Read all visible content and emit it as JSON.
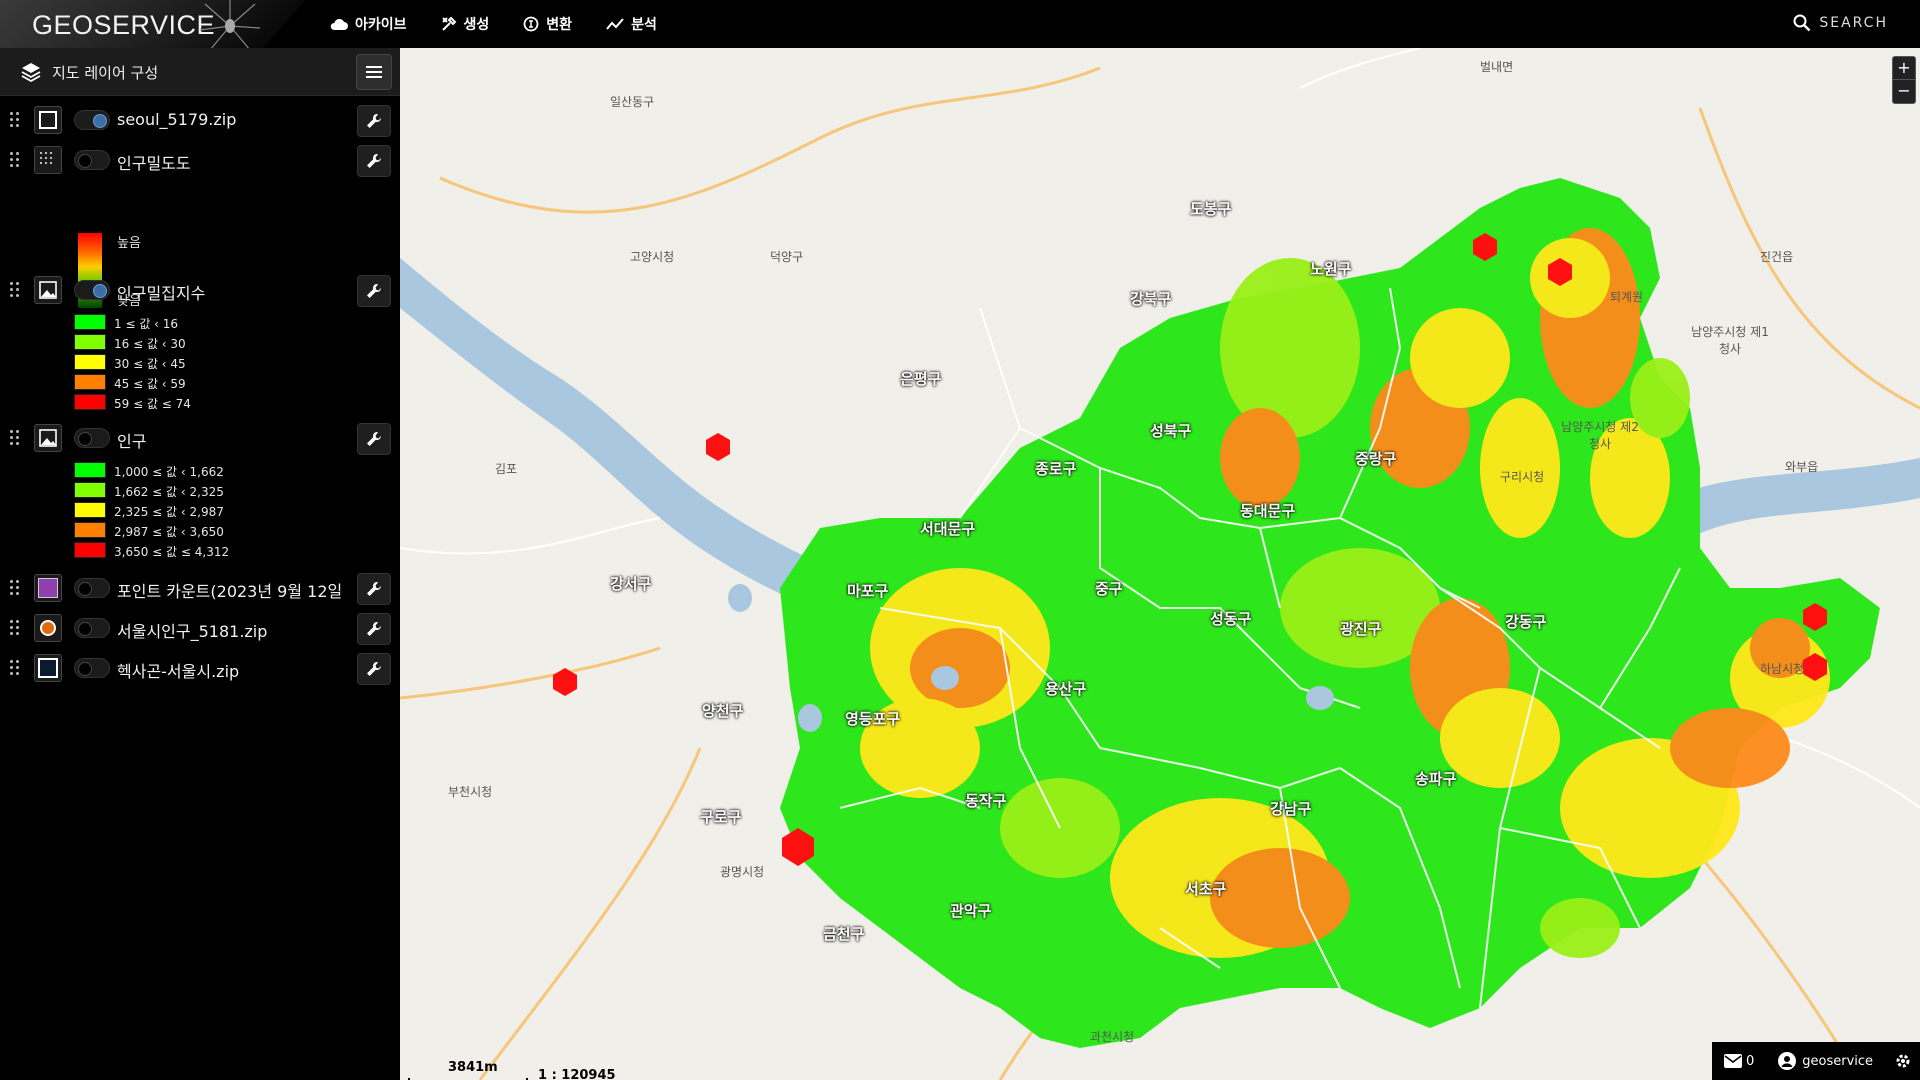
{
  "app": {
    "logo": "GEOSERVICE"
  },
  "menu": [
    {
      "label": "아카이브",
      "icon": "cloud-icon"
    },
    {
      "label": "생성",
      "icon": "tools-icon"
    },
    {
      "label": "변환",
      "icon": "convert-icon"
    },
    {
      "label": "분석",
      "icon": "chart-line-icon"
    }
  ],
  "search": {
    "label": "SEARCH"
  },
  "sidebar": {
    "title": "지도 레이어 구성",
    "layers": [
      {
        "name": "seoul_5179.zip",
        "type": "polygon",
        "on": true
      },
      {
        "name": "인구밀도도",
        "type": "grid",
        "on": false
      },
      {
        "name": "인구밀집지수",
        "type": "image",
        "on": true
      },
      {
        "name": "인구",
        "type": "image",
        "on": false
      },
      {
        "name": "포인트 카운트(2023년 9월 12일",
        "type": "polygon-purple",
        "on": false
      },
      {
        "name": "서울시인구_5181.zip",
        "type": "point",
        "on": false
      },
      {
        "name": "헥사곤-서울시.zip",
        "type": "polygon",
        "on": false
      }
    ],
    "density_legend": {
      "high": "높음",
      "low": "낮음"
    },
    "index_legend": [
      {
        "label": "1 ≤ 값 ‹ 16",
        "color": "#00ff00"
      },
      {
        "label": "16 ≤ 값 ‹ 30",
        "color": "#80ff00"
      },
      {
        "label": "30 ≤ 값 ‹ 45",
        "color": "#ffff00"
      },
      {
        "label": "45 ≤ 값 ‹ 59",
        "color": "#ff8000"
      },
      {
        "label": "59 ≤ 값 ≤ 74",
        "color": "#ff0000"
      }
    ],
    "pop_legend": [
      {
        "label": "1,000 ≤ 값 ‹ 1,662",
        "color": "#00ff00"
      },
      {
        "label": "1,662 ≤ 값 ‹ 2,325",
        "color": "#80ff00"
      },
      {
        "label": "2,325 ≤ 값 ‹ 2,987",
        "color": "#ffff00"
      },
      {
        "label": "2,987 ≤ 값 ‹ 3,650",
        "color": "#ff8000"
      },
      {
        "label": "3,650 ≤ 값 ≤ 4,312",
        "color": "#ff0000"
      }
    ]
  },
  "map": {
    "districts": [
      "도봉구",
      "노원구",
      "강북구",
      "은평구",
      "성북구",
      "종로구",
      "중랑구",
      "서대문구",
      "동대문구",
      "강서구",
      "마포구",
      "중구",
      "성동구",
      "광진구",
      "강동구",
      "양천구",
      "영등포구",
      "용산구",
      "송파구",
      "구로구",
      "동작구",
      "강남구",
      "서초구",
      "관악구",
      "금천구"
    ],
    "place_labels": [
      "일산동구",
      "벌내면",
      "고양시청",
      "덕양구",
      "남양주시청 제1청사",
      "남양주시청 제2청사",
      "구리시청",
      "하남시청",
      "부천시청",
      "광명시청",
      "과천시청",
      "김포",
      "진건읍",
      "퇴계원",
      "와부읍"
    ],
    "scale_distance": "3841m",
    "scale_ratio": "1 : 120945",
    "zoom_in": "+",
    "zoom_out": "−"
  },
  "status": {
    "mail_count": "0",
    "user": "geoservice"
  }
}
